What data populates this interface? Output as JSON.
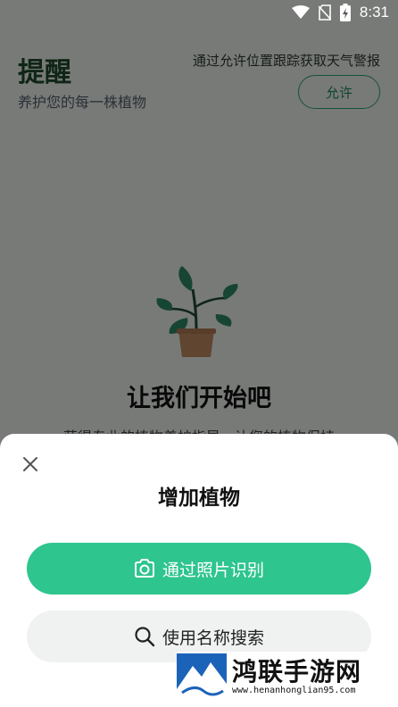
{
  "status_bar": {
    "time": "8:31"
  },
  "header": {
    "title": "提醒",
    "subtitle": "养护您的每一株植物",
    "weather_hint": "通过允许位置跟踪获取天气警报",
    "allow_label": "允许"
  },
  "empty_state": {
    "title": "让我们开始吧",
    "description": "获得专业的植物养护指导，让您的植物保持"
  },
  "sheet": {
    "title": "增加植物",
    "photo_button_label": "通过照片识别",
    "search_button_label": "使用名称搜索"
  },
  "watermark": {
    "name": "鸿联手游网",
    "url": "www.henanhonglian95.com"
  },
  "colors": {
    "primary_green": "#2ec58f",
    "title_green": "#1e4a2a",
    "scrim": "rgba(0,0,0,0.5)"
  }
}
